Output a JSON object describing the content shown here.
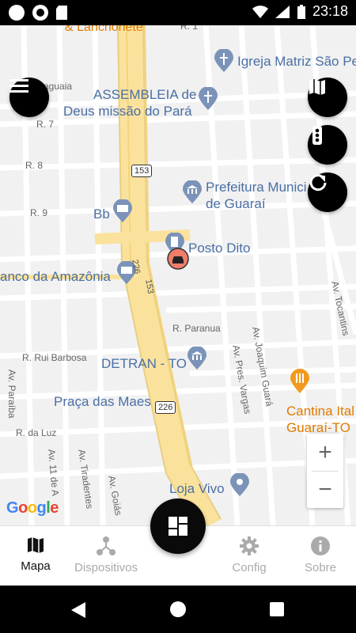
{
  "status_bar": {
    "time": "23:18"
  },
  "map": {
    "pois": {
      "lanchonete": "& Lanchonete",
      "igreja": "Igreja Matriz São Pe",
      "assembleia_l1": "ASSEMBLEIA de",
      "assembleia_l2": "Deus missão do Pará",
      "prefeitura_l1": "Prefeitura Munici",
      "prefeitura_l2": "de Guaraí",
      "bb": "Bb",
      "posto": "Posto Dito",
      "banco": "anco da Amazônia",
      "detran": "DETRAN - TO",
      "praca": "Praça das Maes",
      "cantina_l1": "Cantina Ital",
      "cantina_l2": "Guaraí-TO",
      "loja": "Loja Vivo"
    },
    "streets": {
      "r1": "R. 1",
      "guaiua": "aguaia",
      "r7": "R. 7",
      "r8": "R. 8",
      "r9": "R. 9",
      "paranua": "R. Paranua",
      "rui": "R. Rui Barbosa",
      "luz": "R. da Luz",
      "joaquim": "Av. Joaquim Guará",
      "tocantins": "Av. Tocantins",
      "pres": "Av. Pres. Vargas",
      "paraiba": "Av. Paraíba",
      "av11": "Av. 11 de A",
      "tiradentes": "Av. Tiradentes",
      "goias": "Av. Goiás",
      "br153_a": "153",
      "br153_b": "153",
      "br226_a": "226",
      "br226_b": "226",
      "br226_c": "226"
    },
    "attribution": "Google",
    "zoom": {
      "in": "+",
      "out": "−"
    }
  },
  "bottom_nav": {
    "items": [
      {
        "label": "Mapa",
        "icon": "map-icon",
        "active": true
      },
      {
        "label": "Dispositivos",
        "icon": "device-hub-icon",
        "active": false
      },
      {
        "label": "Config",
        "icon": "gear-icon",
        "active": false
      },
      {
        "label": "Sobre",
        "icon": "info-icon",
        "active": false
      }
    ]
  },
  "colors": {
    "accent": "#000000",
    "road_major": "#fbe29c",
    "poi_blue": "#4a6fa5",
    "poi_orange": "#e07b00"
  }
}
